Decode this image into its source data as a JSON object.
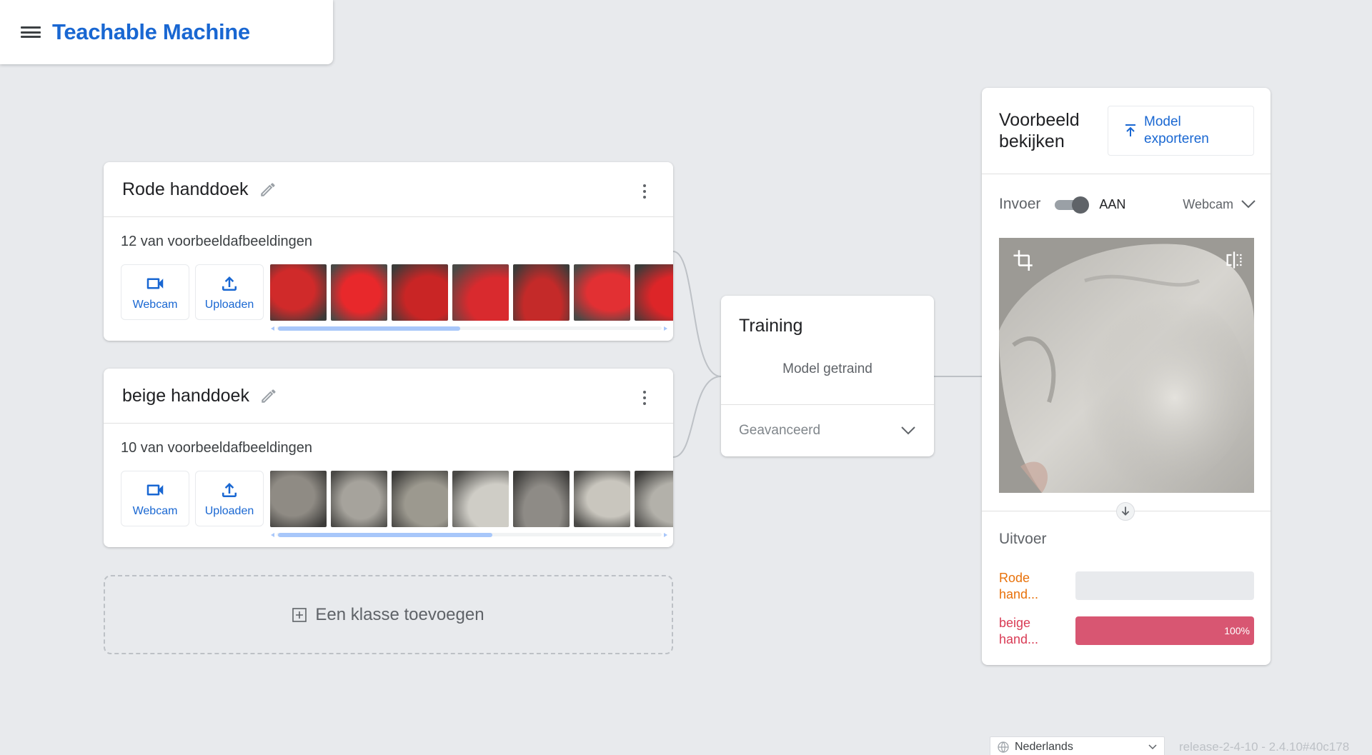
{
  "app": {
    "title": "Teachable Machine"
  },
  "classes": [
    {
      "name": "Rode handdoek",
      "sample_count": "12 van voorbeeldafbeeldingen",
      "webcam_label": "Webcam",
      "upload_label": "Uploaden",
      "thumbnail_colors": [
        "#d02a2a",
        "#e8282b",
        "#c92525",
        "#d92a2e",
        "#c42a29",
        "#e23033",
        "#dd2528"
      ],
      "scroll_fraction": 0.46
    },
    {
      "name": "beige handdoek",
      "sample_count": "10 van voorbeeldafbeeldingen",
      "webcam_label": "Webcam",
      "upload_label": "Uploaden",
      "thumbnail_colors": [
        "#8f8b84",
        "#a6a39c",
        "#9c998f",
        "#cfcdc6",
        "#8e8b86",
        "#c9c6be",
        "#b3b1aa"
      ],
      "scroll_fraction": 0.54
    }
  ],
  "add_class": {
    "label": "Een klasse toevoegen"
  },
  "training": {
    "title": "Training",
    "status": "Model getraind",
    "advanced_label": "Geavanceerd"
  },
  "preview": {
    "title": "Voorbeeld bekijken",
    "export_button": "Model exporteren",
    "input_label": "Invoer",
    "toggle_state": "AAN",
    "input_source": "Webcam",
    "output_title": "Uitvoer",
    "outputs": [
      {
        "label": "Rode hand...",
        "percent": 0,
        "percent_text": "",
        "color": "#e8710a",
        "bar_color": "#e37400"
      },
      {
        "label": "beige hand...",
        "percent": 100,
        "percent_text": "100%",
        "color": "#d93b55",
        "bar_color": "#d85672"
      }
    ]
  },
  "footer": {
    "language": "Nederlands",
    "version": "release-2-4-10 - 2.4.10#40c178"
  },
  "colors": {
    "accent": "#1967d2",
    "background": "#e8eaed"
  }
}
